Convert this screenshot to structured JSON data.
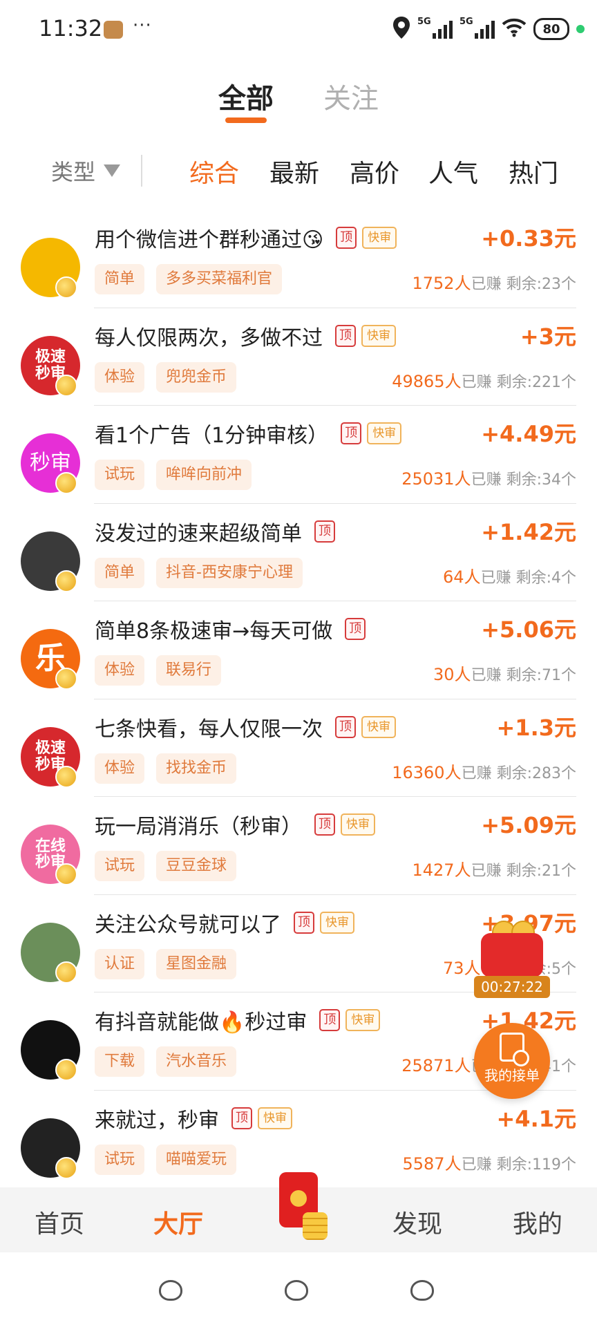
{
  "status_bar": {
    "time": "11:32",
    "more": "···",
    "network_1": "5G",
    "network_2": "5G",
    "battery": "80"
  },
  "top_tabs": [
    {
      "label": "全部",
      "active": true
    },
    {
      "label": "关注",
      "active": false
    }
  ],
  "filters": {
    "type_label": "类型",
    "sorts": [
      {
        "label": "综合",
        "active": true
      },
      {
        "label": "最新",
        "active": false
      },
      {
        "label": "高价",
        "active": false
      },
      {
        "label": "人气",
        "active": false
      },
      {
        "label": "热门",
        "active": false
      }
    ]
  },
  "tags": {
    "top": "顶",
    "fast": "快审"
  },
  "tasks": [
    {
      "title": "用个微信进个群秒通过😘",
      "top": true,
      "fast": true,
      "reward": "+0.33元",
      "category": "简单",
      "merchant": "多多买菜福利官",
      "earned_count": "1752人",
      "earned_suffix": "已赚",
      "remaining": "剩余:23个",
      "avatar_text": "",
      "avatar_color": "#f5b800"
    },
    {
      "title": "每人仅限两次，多做不过",
      "top": true,
      "fast": true,
      "reward": "+3元",
      "category": "体验",
      "merchant": "兜兜金币",
      "earned_count": "49865人",
      "earned_suffix": "已赚",
      "remaining": "剩余:221个",
      "avatar_text": "极速秒审",
      "avatar_color": "#d6282d"
    },
    {
      "title": "看1个广告（1分钟审核）",
      "top": true,
      "fast": true,
      "reward": "+4.49元",
      "category": "试玩",
      "merchant": "哞哞向前冲",
      "earned_count": "25031人",
      "earned_suffix": "已赚",
      "remaining": "剩余:34个",
      "avatar_text": "秒审",
      "avatar_color": "#e62fd6"
    },
    {
      "title": "没发过的速来超级简单",
      "top": true,
      "fast": false,
      "reward": "+1.42元",
      "category": "简单",
      "merchant": "抖音-西安康宁心理",
      "earned_count": "64人",
      "earned_suffix": "已赚",
      "remaining": "剩余:4个",
      "avatar_text": "",
      "avatar_color": "#3a3a3a"
    },
    {
      "title": "简单8条极速审→每天可做",
      "top": true,
      "fast": false,
      "reward": "+5.06元",
      "category": "体验",
      "merchant": "联易行",
      "earned_count": "30人",
      "earned_suffix": "已赚",
      "remaining": "剩余:71个",
      "avatar_text": "乐",
      "avatar_color": "#f46a10"
    },
    {
      "title": "七条快看，每人仅限一次",
      "top": true,
      "fast": true,
      "reward": "+1.3元",
      "category": "体验",
      "merchant": "找找金币",
      "earned_count": "16360人",
      "earned_suffix": "已赚",
      "remaining": "剩余:283个",
      "avatar_text": "极速秒审",
      "avatar_color": "#d6282d"
    },
    {
      "title": "玩一局消消乐（秒审）",
      "top": true,
      "fast": true,
      "reward": "+5.09元",
      "category": "试玩",
      "merchant": "豆豆金球",
      "earned_count": "1427人",
      "earned_suffix": "已赚",
      "remaining": "剩余:21个",
      "avatar_text": "在线秒审",
      "avatar_color": "#f06ba0"
    },
    {
      "title": "关注公众号就可以了",
      "top": true,
      "fast": true,
      "reward": "+3.97元",
      "category": "认证",
      "merchant": "星图金融",
      "earned_count": "73人",
      "earned_suffix": "已赚",
      "remaining": "剩余:5个",
      "avatar_text": "",
      "avatar_color": "#6b8f5a"
    },
    {
      "title": "有抖音就能做🔥秒过审",
      "top": true,
      "fast": true,
      "reward": "+1.42元",
      "category": "下载",
      "merchant": "汽水音乐",
      "earned_count": "25871人",
      "earned_suffix": "已赚",
      "remaining": "剩余:41个",
      "avatar_text": "",
      "avatar_color": "#111111"
    },
    {
      "title": "来就过，秒审",
      "top": true,
      "fast": true,
      "reward": "+4.1元",
      "category": "试玩",
      "merchant": "喵喵爱玩",
      "earned_count": "5587人",
      "earned_suffix": "已赚",
      "remaining": "剩余:119个",
      "avatar_text": "",
      "avatar_color": "#222222"
    }
  ],
  "floating": {
    "timer": "00:27:22",
    "my_orders": "我的接单"
  },
  "bottom_nav": [
    {
      "label": "首页",
      "active": false
    },
    {
      "label": "大厅",
      "active": true
    },
    {
      "label": "发现",
      "active": false
    },
    {
      "label": "我的",
      "active": false
    }
  ],
  "colors": {
    "accent": "#f26a1d",
    "tag_red": "#d63b3b",
    "tag_gold": "#e8962a"
  }
}
